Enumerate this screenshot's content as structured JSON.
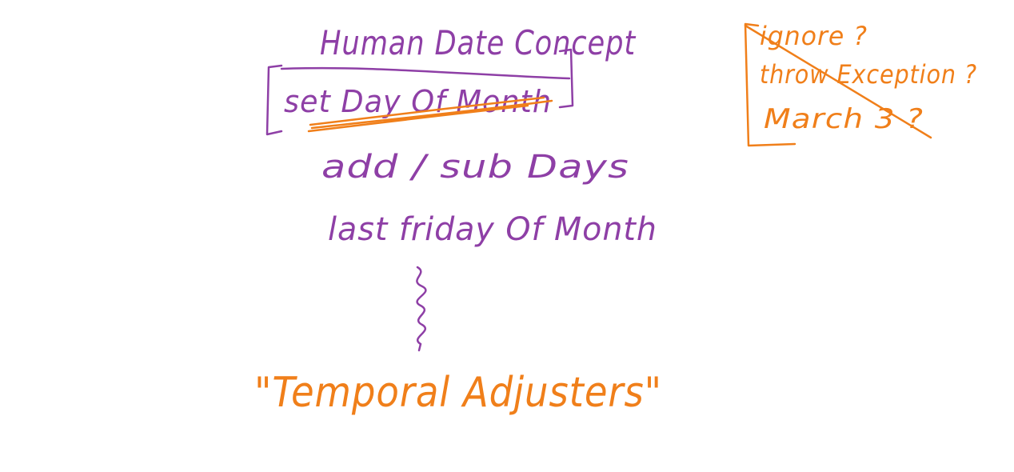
{
  "whiteboard": {
    "title": "Human Date Concept",
    "concepts": {
      "set_day": "set Day Of Month",
      "add_sub": "add / sub Days",
      "last_friday": "last friday Of Month"
    },
    "result": "\"Temporal Adjusters\"",
    "edge_cases": {
      "ignore": "ignore ?",
      "throw": "throw Exception ?",
      "march": "March 3 ?"
    }
  },
  "colors": {
    "purple": "#8e3fa6",
    "orange": "#f07f1a",
    "background": "#ffffff"
  }
}
